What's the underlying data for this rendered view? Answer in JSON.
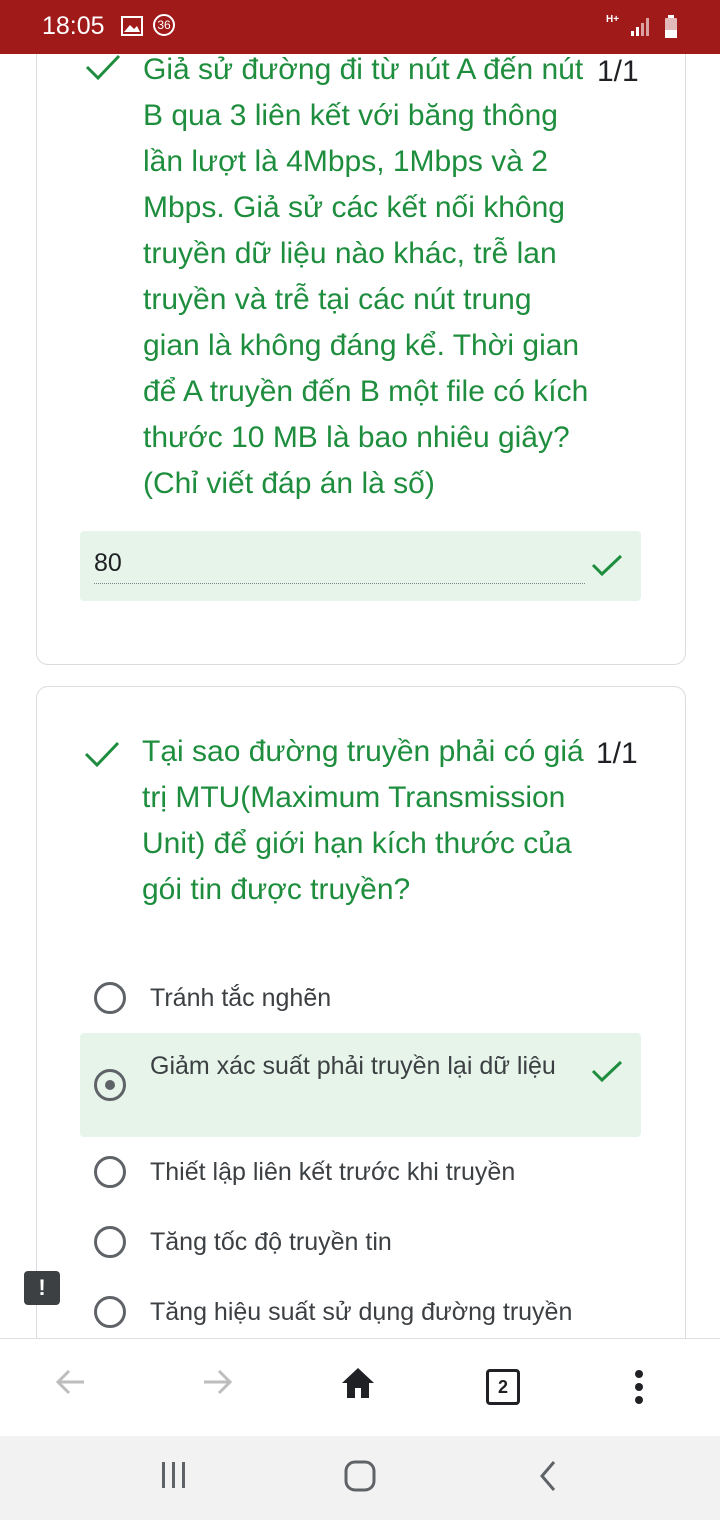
{
  "status_bar": {
    "time": "18:05",
    "notification_count": "36",
    "network_type": "H+",
    "background_color": "#a11a1a"
  },
  "question1": {
    "text": "Giả sử đường đi từ nút A đến nút B qua 3 liên kết với băng thông lần lượt là 4Mbps, 1Mbps và 2 Mbps. Giả sử các kết nối không truyền dữ liệu nào khác, trễ lan truyền và trễ tại các nút trung gian là không đáng kể. Thời gian để A truyền đến B một file có kích thước 10 MB là bao nhiêu giây?(Chỉ viết đáp án là số)",
    "score": "1/1",
    "answer": "80",
    "status_icon": "check-icon"
  },
  "question2": {
    "text": "Tại sao đường truyền phải có giá trị MTU(Maximum Transmission Unit) để giới hạn kích thước của gói tin được truyền?",
    "score": "1/1",
    "status_icon": "check-icon",
    "options": [
      {
        "label": "Tránh tắc nghẽn",
        "selected": false
      },
      {
        "label": "Giảm xác suất phải truyền lại dữ liệu",
        "selected": true,
        "correct": true
      },
      {
        "label": "Thiết lập liên kết trước khi truyền",
        "selected": false
      },
      {
        "label": "Tăng tốc độ truyền tin",
        "selected": false
      },
      {
        "label": "Tăng hiệu suất sử dụng đường truyền",
        "selected": false
      }
    ]
  },
  "feedback": {
    "icon": "report-icon",
    "symbol": "!"
  },
  "browser_toolbar": {
    "tab_count": "2",
    "buttons": [
      "back-arrow-icon",
      "forward-arrow-icon",
      "home-icon",
      "tabs-icon",
      "more-vert-icon"
    ]
  },
  "nav_bar": {
    "buttons": [
      "recent-apps-icon",
      "home-icon",
      "back-icon"
    ]
  },
  "colors": {
    "correct_green": "#1e8e3e",
    "selected_bg": "#e6f4ea",
    "status_bar": "#a11a1a"
  }
}
